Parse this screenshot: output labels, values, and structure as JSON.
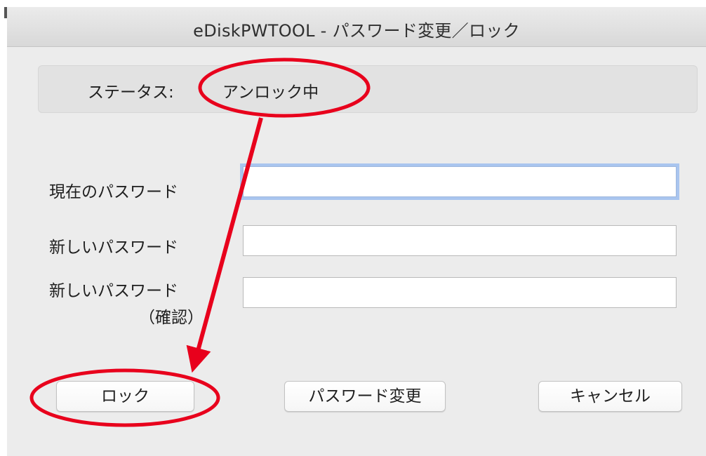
{
  "window": {
    "title": "eDiskPWTOOL - パスワード変更／ロック"
  },
  "status": {
    "label": "ステータス:",
    "value": "アンロック中"
  },
  "form": {
    "current_password_label": "現在のパスワード",
    "current_password_value": "",
    "new_password_label": "新しいパスワード",
    "new_password_value": "",
    "confirm_password_label_line1": "新しいパスワード",
    "confirm_password_label_line2": "（確認）",
    "confirm_password_value": ""
  },
  "buttons": {
    "lock_label": "ロック",
    "change_password_label": "パスワード変更",
    "cancel_label": "キャンセル"
  },
  "annotation": {
    "color": "#e8001c"
  }
}
